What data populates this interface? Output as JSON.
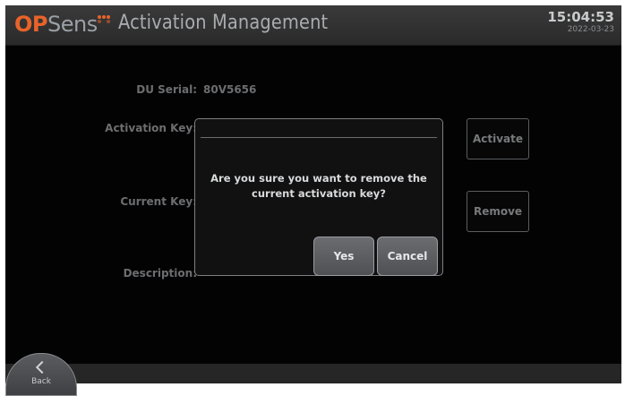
{
  "header": {
    "logo_op": "OP",
    "logo_sens": "Sens",
    "title": "Activation Management",
    "time": "15:04:53",
    "date": "2022-03-23"
  },
  "form": {
    "du_serial_label": "DU Serial:",
    "du_serial_value": "80V5656",
    "activation_key_label": "Activation Key:",
    "current_key_label": "Current Key:",
    "description_label": "Description:"
  },
  "buttons": {
    "activate": "Activate",
    "remove": "Remove",
    "back": "Back"
  },
  "dialog": {
    "message": "Are you sure you want to remove the current activation key?",
    "yes": "Yes",
    "cancel": "Cancel"
  },
  "colors": {
    "brand_orange": "#e8632a",
    "background": "#050505"
  }
}
